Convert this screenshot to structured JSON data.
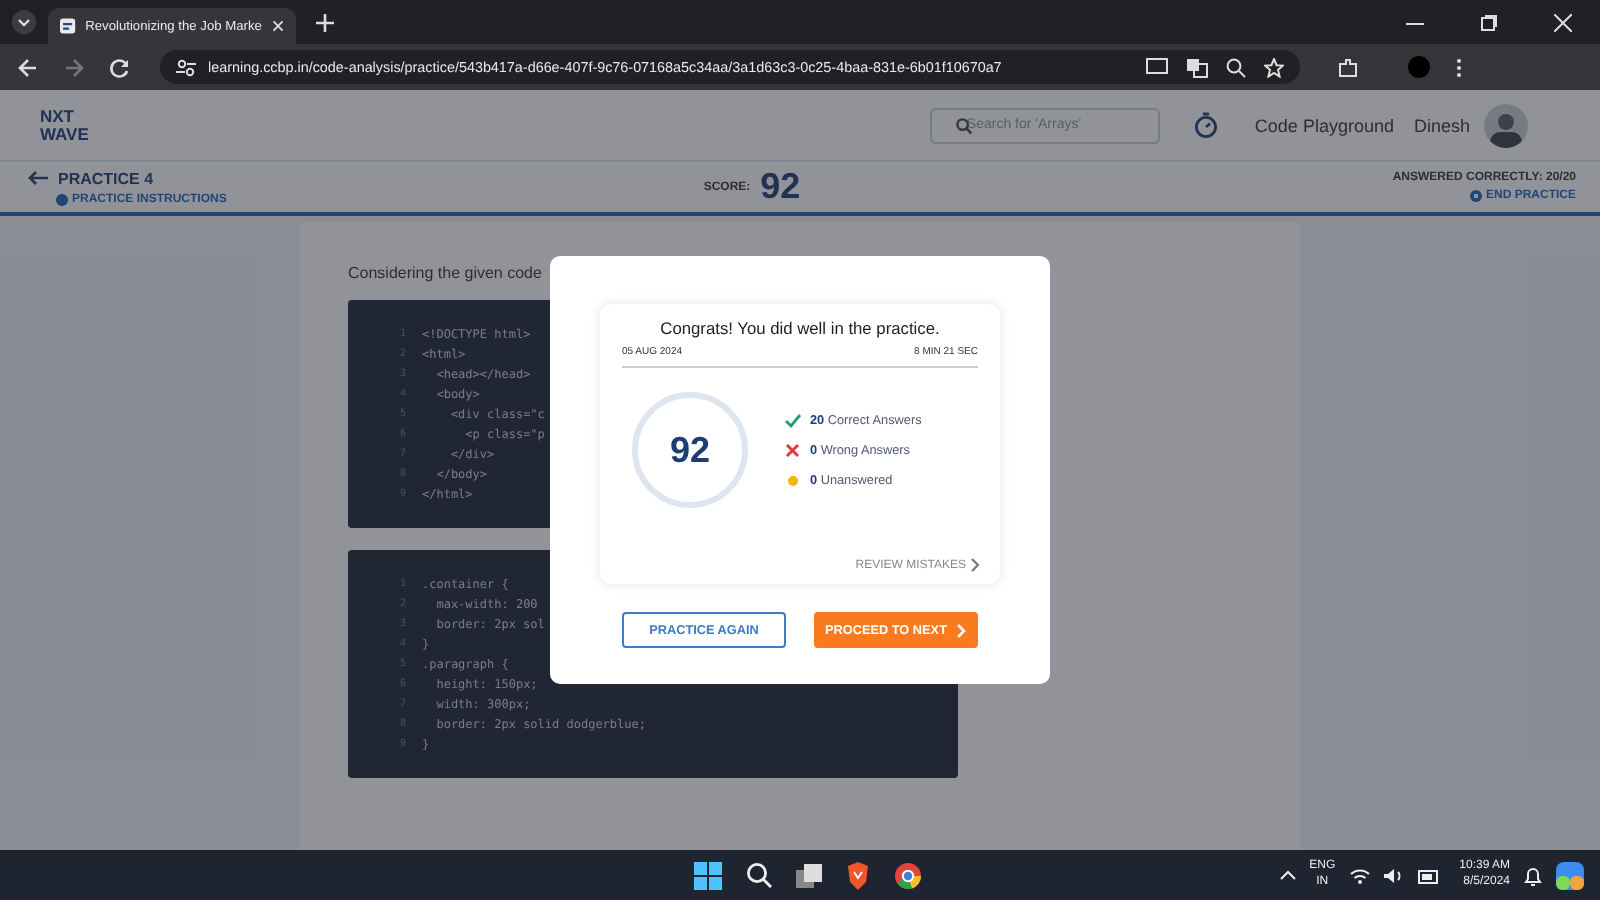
{
  "browser": {
    "tab_title": "Revolutionizing the Job Marke",
    "url": "learning.ccbp.in/code-analysis/practice/543b417a-d66e-407f-9c76-07168a5c34aa/3a1d63c3-0c25-4baa-831e-6b01f10670a7"
  },
  "header": {
    "logo": [
      "NXT",
      "WAVE"
    ],
    "search_placeholder": "Search for 'Arrays'",
    "nav_link": "Code Playground",
    "user": "Dinesh"
  },
  "subheader": {
    "title": "PRACTICE 4",
    "instructions": "PRACTICE INSTRUCTIONS",
    "score_label": "SCORE:",
    "score": "92",
    "answered": "ANSWERED CORRECTLY: 20/20",
    "end": "END PRACTICE"
  },
  "question": {
    "text": "Considering the given code",
    "code_blocks": [
      {
        "lines": [
          {
            "number": "1",
            "code": "<!DOCTYPE html>"
          },
          {
            "number": "2",
            "code": "<html>"
          },
          {
            "number": "3",
            "code": "  <head></head>"
          },
          {
            "number": "4",
            "code": "  <body>"
          },
          {
            "number": "5",
            "code": "    <div class=\"c"
          },
          {
            "number": "6",
            "code": "      <p class=\"p"
          },
          {
            "number": "7",
            "code": "    </div>"
          },
          {
            "number": "8",
            "code": "  </body>"
          },
          {
            "number": "9",
            "code": "</html>"
          }
        ]
      },
      {
        "lines": [
          {
            "number": "1",
            "code": ".container {"
          },
          {
            "number": "2",
            "code": "  max-width: 200"
          },
          {
            "number": "3",
            "code": "  border: 2px sol"
          },
          {
            "number": "4",
            "code": "}"
          },
          {
            "number": "5",
            "code": ".paragraph {"
          },
          {
            "number": "6",
            "code": "  height: 150px;"
          },
          {
            "number": "7",
            "code": "  width: 300px;"
          },
          {
            "number": "8",
            "code": "  border: 2px solid dodgerblue;"
          },
          {
            "number": "9",
            "code": "}"
          }
        ]
      }
    ]
  },
  "modal": {
    "title": "Congrats! You did well in the practice.",
    "date": "05 AUG 2024",
    "duration": "8 MIN 21 SEC",
    "score": "92",
    "stats": [
      {
        "kind": "correct",
        "count": "20",
        "label": "Correct Answers"
      },
      {
        "kind": "wrong",
        "count": "0",
        "label": "Wrong Answers"
      },
      {
        "kind": "unanswered",
        "count": "0",
        "label": "Unanswered"
      }
    ],
    "review": "REVIEW MISTAKES",
    "buttons": [
      {
        "kind": "outline",
        "label": "PRACTICE AGAIN"
      },
      {
        "kind": "primary",
        "label": "PROCEED TO NEXT"
      }
    ]
  },
  "taskbar": {
    "lang": "ENG",
    "region": "IN",
    "time": "10:39 AM",
    "date": "8/5/2024"
  }
}
